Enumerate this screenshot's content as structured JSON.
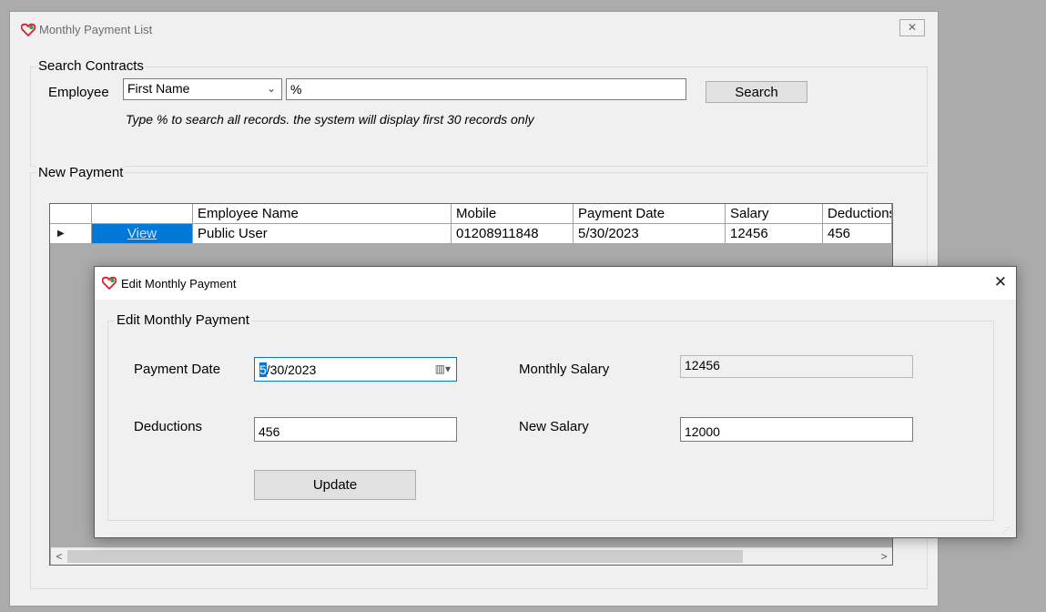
{
  "main_window": {
    "title": "Monthly Payment List",
    "icon": "app-heart-icon",
    "close_glyph": "✕"
  },
  "search_group": {
    "legend": "Search Contracts",
    "employee_label": "Employee",
    "field_select_value": "First Name",
    "search_value": "%",
    "search_button": "Search",
    "hint": "Type % to search all records. the system will display first 30 records only"
  },
  "payment_group": {
    "legend": "New Payment"
  },
  "grid": {
    "columns": [
      "",
      "",
      "Employee Name",
      "Mobile",
      "Payment Date",
      "Salary",
      "Deductions"
    ],
    "rows": [
      {
        "selector": "▶",
        "action": "View",
        "employee_name": "Public User",
        "mobile": "01208911848",
        "payment_date": "5/30/2023",
        "salary": "12456",
        "deductions": "456"
      }
    ],
    "scroll_left": "<",
    "scroll_right": ">"
  },
  "dialog": {
    "title": "Edit Monthly Payment",
    "close_glyph": "✕",
    "group_legend": "Edit Monthly Payment",
    "payment_date_label": "Payment Date",
    "payment_date_first": "5",
    "payment_date_rest": "/30/2023",
    "monthly_salary_label": "Monthly Salary",
    "monthly_salary_value": "12456",
    "deductions_label": "Deductions",
    "deductions_value": "456",
    "new_salary_label": "New Salary",
    "new_salary_value": "12000",
    "update_button": "Update"
  },
  "colors": {
    "selection": "#0078d7",
    "window_bg": "#f0f0f0",
    "backdrop": "#ababab"
  }
}
